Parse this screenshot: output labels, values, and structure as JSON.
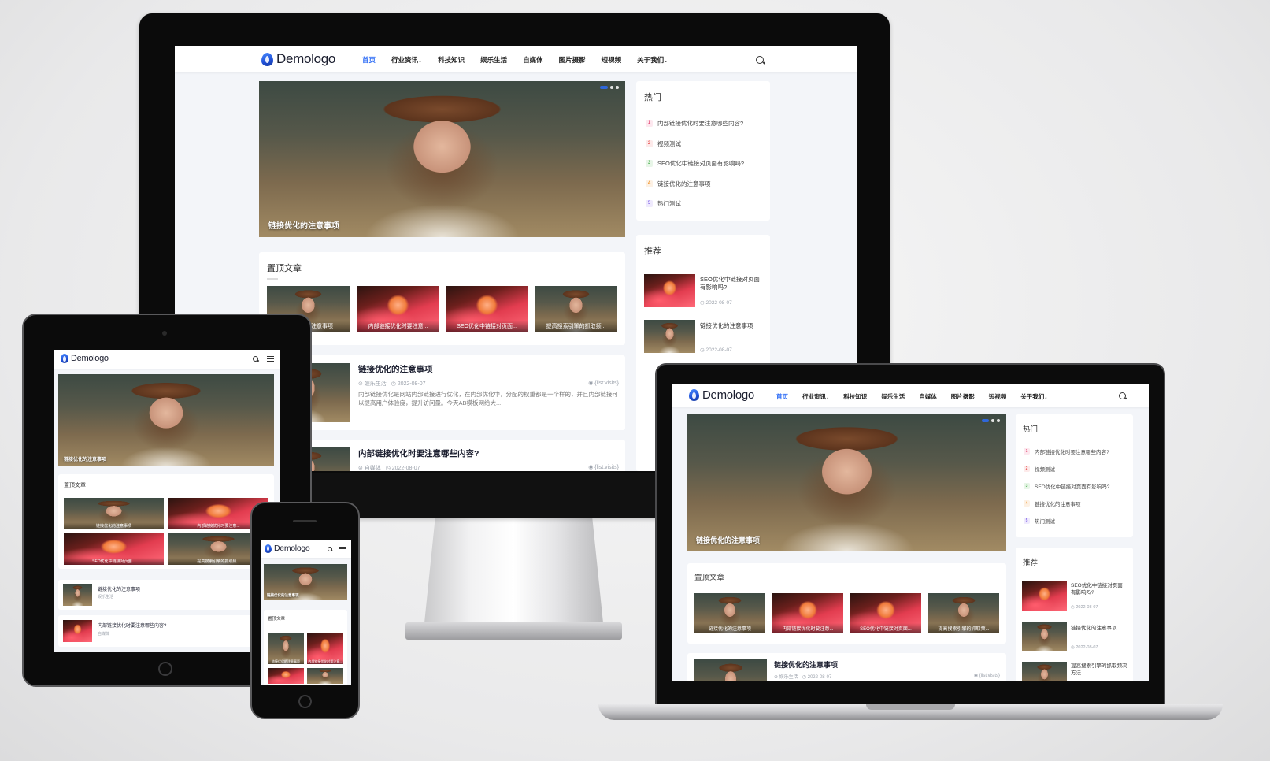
{
  "brand": {
    "logo": "Demologo",
    "accent": "#2d6cf5"
  },
  "nav": {
    "items": [
      {
        "label": "首页",
        "active": true
      },
      {
        "label": "行业资讯",
        "dropdown": true
      },
      {
        "label": "科技知识"
      },
      {
        "label": "娱乐生活"
      },
      {
        "label": "自媒体"
      },
      {
        "label": "图片摄影"
      },
      {
        "label": "短视频"
      },
      {
        "label": "关于我们",
        "dropdown": true
      }
    ]
  },
  "slider": {
    "caption": "链接优化的注意事项"
  },
  "hot": {
    "title": "热门",
    "items": [
      {
        "num": "1",
        "text": "内部链接优化时要注意哪些内容?",
        "color": "#e34f79"
      },
      {
        "num": "2",
        "text": "视频测试",
        "color": "#e85656"
      },
      {
        "num": "3",
        "text": "SEO优化中链接对页面有影响吗?",
        "color": "#4caf50"
      },
      {
        "num": "4",
        "text": "链接优化的注意事项",
        "color": "#f0952d"
      },
      {
        "num": "5",
        "text": "热门测试",
        "color": "#8a6de9"
      }
    ]
  },
  "recommend": {
    "title": "推荐",
    "items": [
      {
        "title": "SEO优化中链接对页面有影响吗?",
        "date": "2022-08-07"
      },
      {
        "title": "链接优化的注意事项",
        "date": "2022-08-07"
      },
      {
        "title": "提高搜索引擎的抓取频次方法",
        "date": ""
      }
    ]
  },
  "sticky": {
    "title": "置顶文章",
    "items": [
      {
        "caption": "链接优化的注意事项"
      },
      {
        "caption": "内部链接优化时要注意..."
      },
      {
        "caption": "SEO优化中链接对页面..."
      },
      {
        "caption": "提高搜索引擎的抓取频..."
      }
    ]
  },
  "posts": [
    {
      "title": "链接优化的注意事项",
      "category": "娱乐生活",
      "date": "2022-08-07",
      "views": "{list:visits}",
      "excerpt": "内部链接优化是网站内部链接进行优化，在内部优化中，分配的权重都是一个样的，并且内部链接可以提高用户体验度，提升访问量。今天AB模板网给大..."
    },
    {
      "title": "内部链接优化时要注意哪些内容?",
      "category": "自媒体",
      "date": "2022-08-07",
      "views": "{list:visits}"
    }
  ],
  "tablet": {
    "sticky_title": "置顶文章",
    "list": [
      {
        "title": "链接优化的注意事项",
        "meta": "娱乐生活"
      },
      {
        "title": "内部链接优化时要注意哪些内容?",
        "meta": "自媒体"
      }
    ]
  }
}
